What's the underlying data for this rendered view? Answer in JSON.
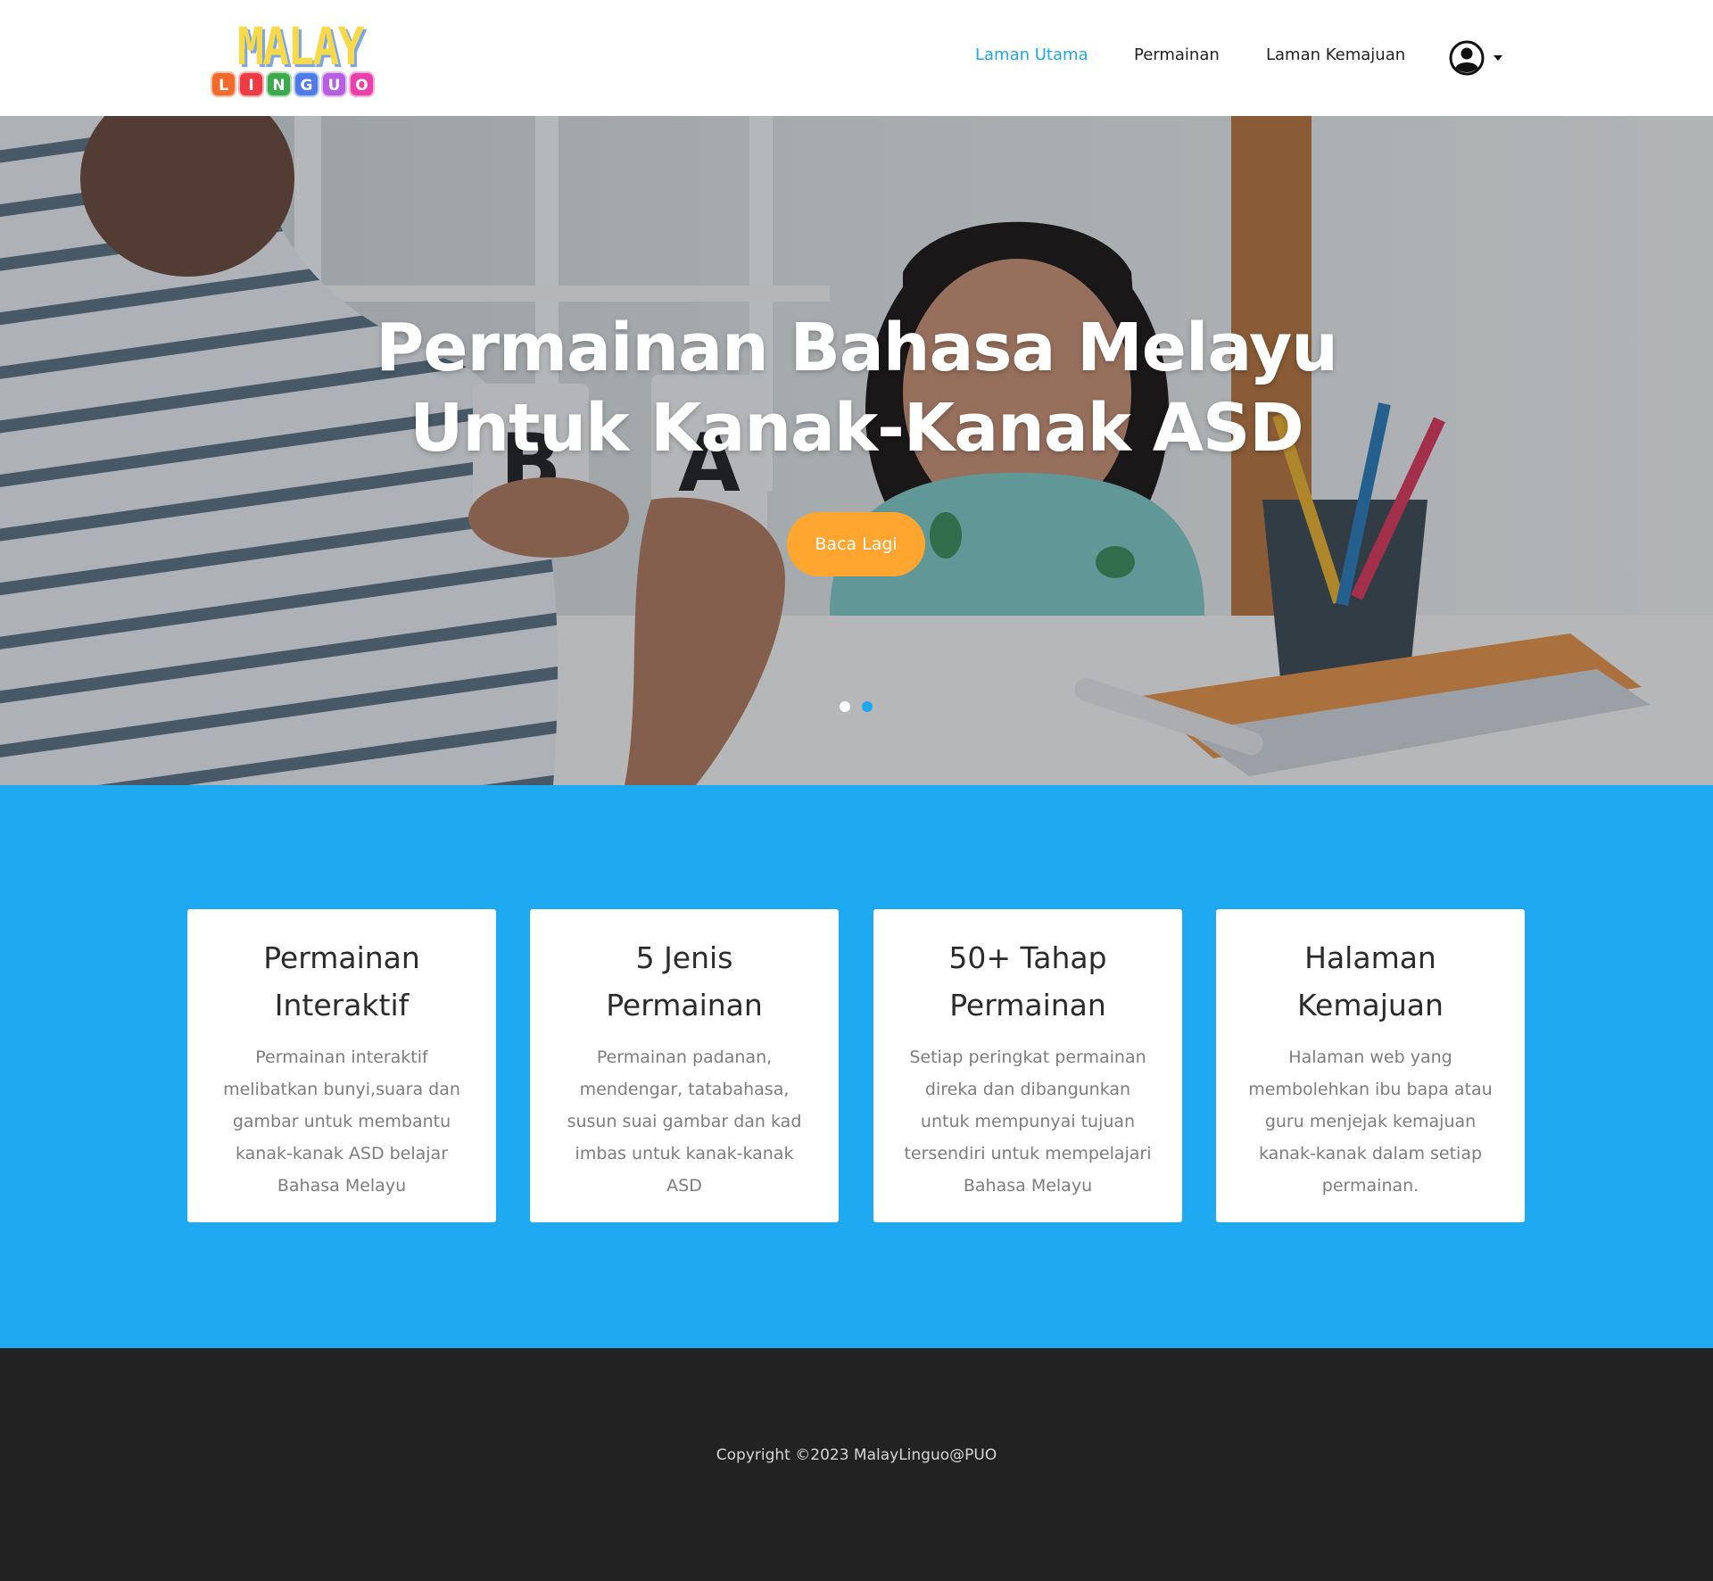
{
  "brand": {
    "logo_top": "MALAY",
    "logo_letters": [
      "L",
      "I",
      "N",
      "G",
      "U",
      "O"
    ],
    "logo_colors": [
      "#f26b2d",
      "#ee3a43",
      "#3aaa4c",
      "#4f7be8",
      "#b65fe0",
      "#ec3fa9"
    ]
  },
  "nav": {
    "items": [
      {
        "label": "Laman Utama",
        "active": true
      },
      {
        "label": "Permainan",
        "active": false
      },
      {
        "label": "Laman Kemajuan",
        "active": false
      }
    ],
    "user_icon": "user-circle-icon",
    "dropdown_icon": "caret-down-icon"
  },
  "hero": {
    "title_line1": "Permainan Bahasa Melayu",
    "title_line2": "Untuk Kanak-Kanak ASD",
    "button_label": "Baca Lagi",
    "slides": 2,
    "active_slide": 2,
    "accent": "#1ea8ee",
    "button_color": "#ffa630"
  },
  "features": {
    "background": "#1fa9f0",
    "cards": [
      {
        "title": "Permainan Interaktif",
        "text": "Permainan interaktif melibatkan bunyi,suara dan gambar untuk membantu kanak-kanak ASD belajar Bahasa Melayu"
      },
      {
        "title": "5 Jenis Permainan",
        "text": "Permainan padanan, mendengar, tatabahasa, susun suai gambar dan kad imbas untuk kanak-kanak ASD"
      },
      {
        "title": "50+ Tahap Permainan",
        "text": "Setiap peringkat permainan direka dan dibangunkan untuk mempunyai tujuan tersendiri untuk mempelajari Bahasa Melayu"
      },
      {
        "title": "Halaman Kemajuan",
        "text": "Halaman web yang membolehkan ibu bapa atau guru menjejak kemajuan kanak-kanak dalam setiap permainan."
      }
    ]
  },
  "footer": {
    "copyright": "Copyright ©2023 MalayLinguo@PUO"
  }
}
